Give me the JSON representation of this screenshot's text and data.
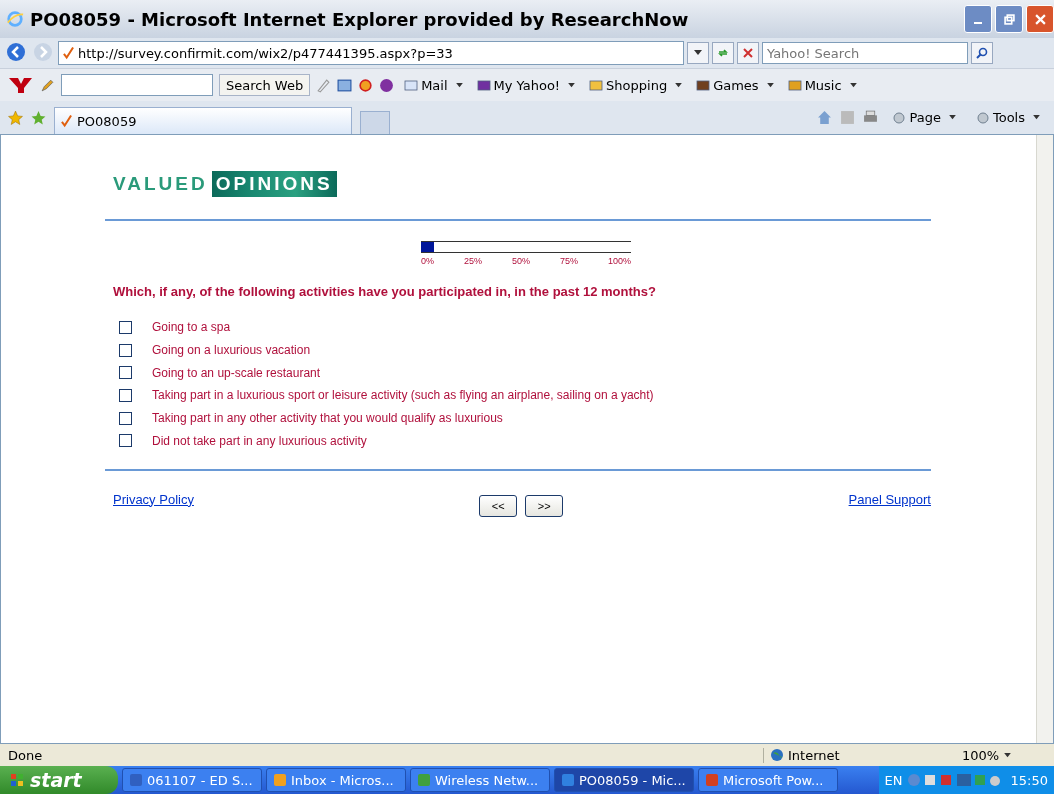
{
  "window": {
    "title": "PO08059 - Microsoft Internet Explorer provided by ResearchNow"
  },
  "address_bar": {
    "url": "http://survey.confirmit.com/wix2/p477441395.aspx?p=33",
    "search_placeholder": "Yahoo! Search"
  },
  "yahoo_toolbar": {
    "search_button": "Search Web",
    "items": [
      "Mail",
      "My Yahoo!",
      "Shopping",
      "Games",
      "Music"
    ]
  },
  "tab": {
    "title": "PO08059"
  },
  "command_bar": {
    "items": [
      "Page",
      "Tools"
    ]
  },
  "page": {
    "logo": {
      "first": "VALUED",
      "second": "OPINIONS"
    },
    "progress": {
      "level": 0.06,
      "ticks": [
        "0%",
        "25%",
        "50%",
        "75%",
        "100%"
      ]
    },
    "question": "Which, if any, of the following activities have you participated in, in the past 12 months?",
    "options": [
      {
        "label": "Going to a spa",
        "checked": false
      },
      {
        "label": "Going on a luxurious vacation",
        "checked": false
      },
      {
        "label": "Going to an up-scale restaurant",
        "checked": false
      },
      {
        "label": "Taking part in a luxurious sport or leisure activity (such as flying an airplane, sailing on a yacht)",
        "checked": false
      },
      {
        "label": "Taking part in any other activity that you would qualify as luxurious",
        "checked": false
      },
      {
        "label": "Did not take part in any luxurious activity",
        "checked": false
      }
    ],
    "privacy_link": "Privacy Policy",
    "buttons": [
      "<<",
      ">>"
    ],
    "support_link": "Panel Support"
  },
  "status_bar": {
    "text": "Done",
    "zone": "Internet",
    "zoom": "100%"
  },
  "taskbar": {
    "start": "start",
    "tasks": [
      {
        "label": "061107 - ED S...",
        "selected": false
      },
      {
        "label": "Inbox - Micros...",
        "selected": false
      },
      {
        "label": "Wireless Netw...",
        "selected": false
      },
      {
        "label": "PO08059 - Mic...",
        "selected": true
      },
      {
        "label": "Microsoft Pow...",
        "selected": false
      }
    ],
    "language": "EN",
    "clock": "15:50"
  }
}
